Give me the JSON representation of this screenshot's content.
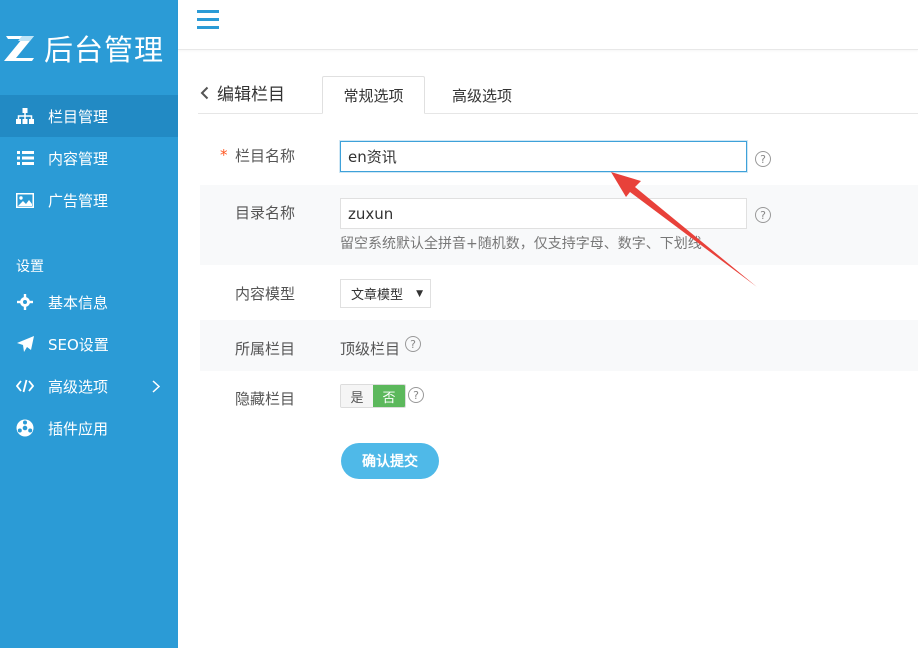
{
  "sidebar": {
    "logo_text": "后台管理",
    "items": [
      {
        "label": "栏目管理",
        "icon": "sitemap-icon",
        "active": true
      },
      {
        "label": "内容管理",
        "icon": "list-icon"
      },
      {
        "label": "广告管理",
        "icon": "image-icon"
      }
    ],
    "section_title": "设置",
    "settings": [
      {
        "label": "基本信息",
        "icon": "gear-icon"
      },
      {
        "label": "SEO设置",
        "icon": "paper-plane-icon"
      },
      {
        "label": "高级选项",
        "icon": "code-icon",
        "has_submenu": true
      },
      {
        "label": "插件应用",
        "icon": "puzzle-ball-icon"
      }
    ]
  },
  "header": {
    "menu_icon": "hamburger-icon"
  },
  "page": {
    "back_label": "编辑栏目",
    "tabs": [
      {
        "label": "常规选项",
        "active": true
      },
      {
        "label": "高级选项",
        "active": false
      }
    ]
  },
  "form": {
    "name": {
      "label": "栏目名称",
      "required_mark": "*",
      "value": "en资讯"
    },
    "dir": {
      "label": "目录名称",
      "value": "zuxun",
      "hint": "留空系统默认全拼音+随机数，仅支持字母、数字、下划线"
    },
    "model": {
      "label": "内容模型",
      "selected": "文章模型"
    },
    "parent": {
      "label": "所属栏目",
      "value": "顶级栏目"
    },
    "hidden": {
      "label": "隐藏栏目",
      "yes": "是",
      "no": "否",
      "selected": "否"
    },
    "help_glyph": "?",
    "submit_label": "确认提交"
  },
  "colors": {
    "sidebar_bg": "#2b9bd6",
    "sidebar_active": "#228ac4",
    "submit_bg": "#4fb9e8",
    "toggle_on": "#5cb85c",
    "required": "#ff5722",
    "annotation_arrow": "#e8413a"
  }
}
